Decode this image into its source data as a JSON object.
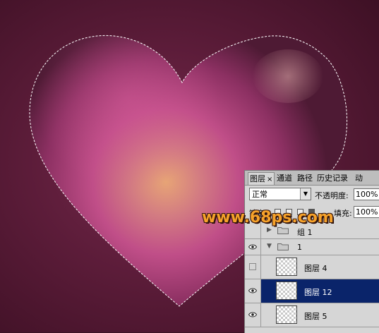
{
  "watermark": "www.68ps.com",
  "panel": {
    "tabs": [
      "图层",
      "通道",
      "路径",
      "历史记录",
      "动"
    ],
    "tab_close": "×",
    "blend_mode": "正常",
    "opacity_label": "不透明度:",
    "opacity_value": "100%",
    "lock_label": "锁定:",
    "fill_label": "填充:",
    "fill_value": "100%",
    "layers": [
      {
        "name": "组 1",
        "type": "group",
        "expanded": false,
        "visible": false
      },
      {
        "name": "1",
        "type": "group",
        "expanded": true,
        "visible": true
      },
      {
        "name": "图层 4",
        "type": "layer",
        "visible": false,
        "selected": false
      },
      {
        "name": "图层 12",
        "type": "layer",
        "visible": true,
        "selected": true
      },
      {
        "name": "图层 5",
        "type": "layer",
        "visible": true,
        "selected": false
      }
    ]
  },
  "colors": {
    "background": "#3a1424",
    "heart_pink": "#c4508a",
    "heart_glow": "#e0a070",
    "selection": "#0a246a",
    "watermark": "#f6a22a"
  }
}
